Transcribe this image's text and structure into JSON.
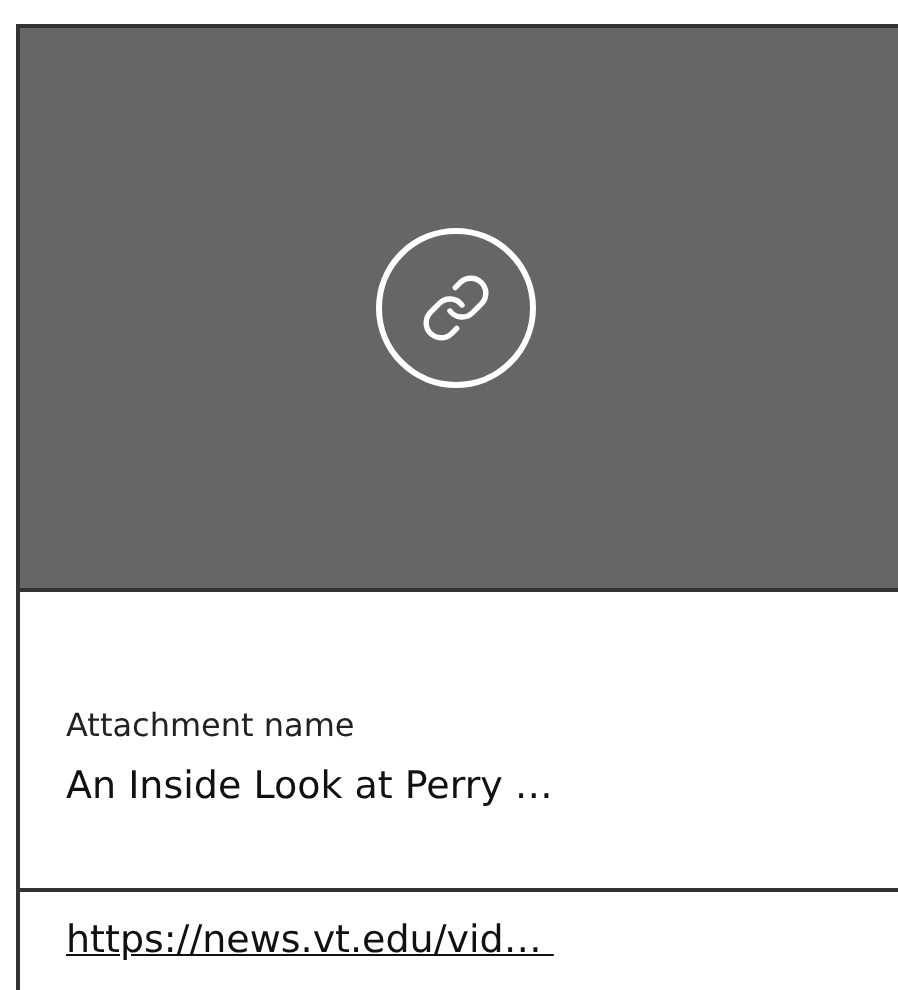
{
  "attachment": {
    "label": "Attachment name",
    "name": "An Inside Look at Perry …",
    "url": "https://news.vt.edu/vid… "
  }
}
